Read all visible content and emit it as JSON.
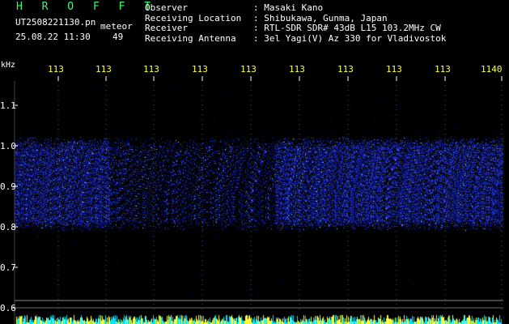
{
  "header": {
    "station": "H R O F F T",
    "filename": "UT2508221130.pn",
    "tag": "meteor",
    "datetime": "25.08.22 11:30",
    "count": "49"
  },
  "info": {
    "labels": [
      "Observer",
      "Receiving Location",
      "Receiver",
      "Receiving Antenna"
    ],
    "values": [
      ": Masaki Kano",
      ": Shibukawa, Gunma, Japan",
      ": RTL-SDR SDR# 43dB L15 103.2MHz CW",
      ": 3el Yagi(V) Az 330 for Vladivostok"
    ]
  },
  "axis": {
    "unit": "kHz",
    "y_ticks": [
      "1.1",
      "1.0",
      "0.9",
      "0.8",
      "0.7",
      "0.6"
    ],
    "x_ticks": [
      "113",
      "113",
      "113",
      "113",
      "113",
      "113",
      "113",
      "113",
      "113",
      "1140"
    ]
  },
  "colors": {
    "background": "#000000",
    "station": "#33ff66",
    "x_ticks": "#ffff33",
    "signal": "#2233ff",
    "baseline": "#00e5ff"
  }
}
